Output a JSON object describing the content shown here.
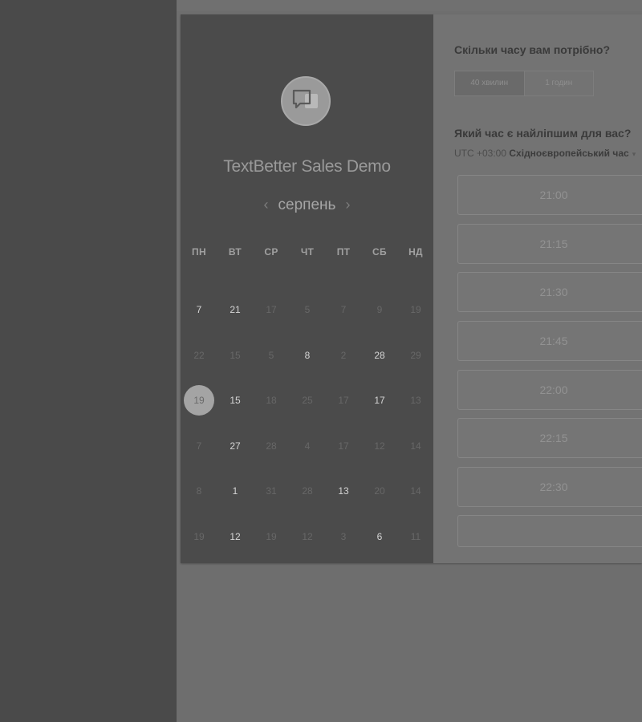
{
  "event": {
    "title": "TextBetter Sales Demo",
    "logo_icon": "chat-bubble-icon"
  },
  "calendar": {
    "month_label": "серпень",
    "prev_icon": "chevron-left-icon",
    "next_icon": "chevron-right-icon",
    "prev_glyph": "‹",
    "next_glyph": "›",
    "weekdays": [
      "ПН",
      "ВТ",
      "СР",
      "ЧТ",
      "ПТ",
      "СБ",
      "НД"
    ],
    "weeks": [
      [
        {
          "d": "7",
          "a": true
        },
        {
          "d": "21",
          "a": true
        },
        {
          "d": "17",
          "a": false
        },
        {
          "d": "5",
          "a": false
        },
        {
          "d": "7",
          "a": false
        },
        {
          "d": "9",
          "a": false
        },
        {
          "d": "19",
          "a": false
        }
      ],
      [
        {
          "d": "22",
          "a": false
        },
        {
          "d": "15",
          "a": false
        },
        {
          "d": "5",
          "a": false
        },
        {
          "d": "8",
          "a": true
        },
        {
          "d": "2",
          "a": false
        },
        {
          "d": "28",
          "a": true
        },
        {
          "d": "29",
          "a": false
        }
      ],
      [
        {
          "d": "19",
          "a": true,
          "selected": true
        },
        {
          "d": "15",
          "a": true
        },
        {
          "d": "18",
          "a": false
        },
        {
          "d": "25",
          "a": false
        },
        {
          "d": "17",
          "a": false
        },
        {
          "d": "17",
          "a": true
        },
        {
          "d": "13",
          "a": false
        }
      ],
      [
        {
          "d": "7",
          "a": false
        },
        {
          "d": "27",
          "a": true
        },
        {
          "d": "28",
          "a": false
        },
        {
          "d": "4",
          "a": false
        },
        {
          "d": "17",
          "a": false
        },
        {
          "d": "12",
          "a": false
        },
        {
          "d": "14",
          "a": false
        }
      ],
      [
        {
          "d": "8",
          "a": false
        },
        {
          "d": "1",
          "a": true
        },
        {
          "d": "31",
          "a": false
        },
        {
          "d": "28",
          "a": false
        },
        {
          "d": "13",
          "a": true
        },
        {
          "d": "20",
          "a": false
        },
        {
          "d": "14",
          "a": false
        }
      ],
      [
        {
          "d": "19",
          "a": false
        },
        {
          "d": "12",
          "a": true
        },
        {
          "d": "19",
          "a": false
        },
        {
          "d": "12",
          "a": false
        },
        {
          "d": "3",
          "a": false
        },
        {
          "d": "6",
          "a": true
        },
        {
          "d": "11",
          "a": false
        }
      ]
    ]
  },
  "booking": {
    "duration_question": "Скільки часу вам потрібно?",
    "durations": [
      {
        "label": "40 хвилин",
        "active": true
      },
      {
        "label": "1 годин",
        "active": false
      }
    ],
    "time_question": "Який час є найліпшим для вас?",
    "timezone": {
      "utc": "UTC +03:00",
      "name": "Східноєвропейський час",
      "caret": "▾"
    },
    "slots": [
      "21:00",
      "21:15",
      "21:30",
      "21:45",
      "22:00",
      "22:15",
      "22:30",
      ""
    ]
  }
}
